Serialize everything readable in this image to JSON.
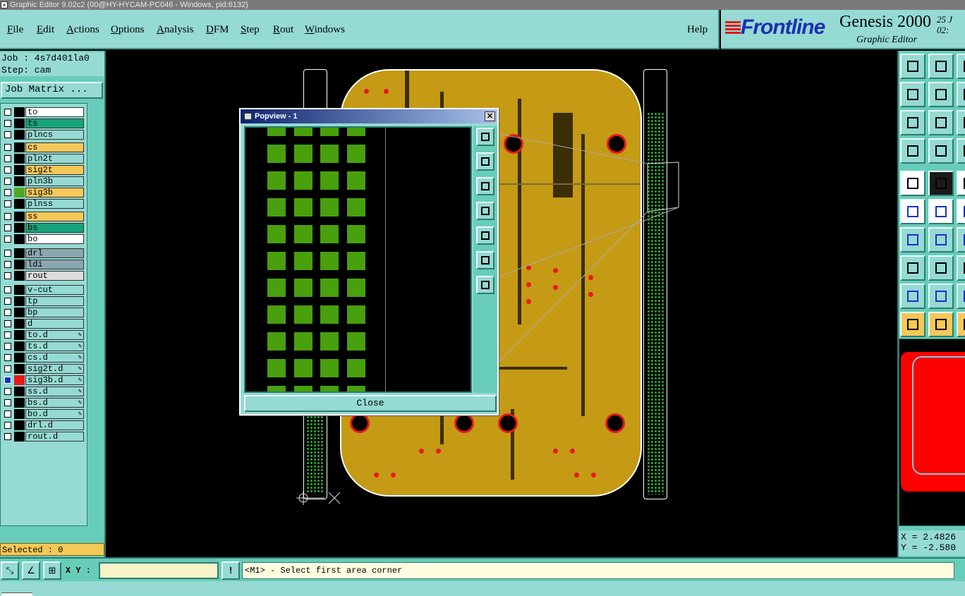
{
  "window": {
    "title": "Graphic Editor 9.02c2 (00@HY-HYCAM-PC046 - Windows, pid:6132)"
  },
  "menu": {
    "items": [
      {
        "label": "File",
        "u": "F",
        "rest": "ile"
      },
      {
        "label": "Edit",
        "u": "E",
        "rest": "dit"
      },
      {
        "label": "Actions",
        "u": "A",
        "rest": "ctions"
      },
      {
        "label": "Options",
        "u": "O",
        "rest": "ptions"
      },
      {
        "label": "Analysis",
        "u": "A",
        "rest": "nalysis"
      },
      {
        "label": "DFM",
        "u": "D",
        "rest": "FM"
      },
      {
        "label": "Step",
        "u": "S",
        "rest": "tep"
      },
      {
        "label": "Rout",
        "u": "R",
        "rest": "out"
      },
      {
        "label": "Windows",
        "u": "W",
        "rest": "indows"
      }
    ],
    "help": "Help"
  },
  "brand": {
    "logo": "Frontline",
    "product": "Genesis 2000",
    "subtitle": "Graphic Editor",
    "date_line1": "25 J",
    "date_line2": "02:"
  },
  "job": {
    "job_line": "Job : 4s7d401la0",
    "step_line": "Step: cam",
    "matrix_button": "Job Matrix ..."
  },
  "layers": [
    {
      "name": "to",
      "color": "#ffffff",
      "swatch": "#000000",
      "editable": false
    },
    {
      "name": "ts",
      "color": "#17a37a",
      "swatch": "#000000",
      "editable": false
    },
    {
      "name": "plncs",
      "color": "#95dad3",
      "swatch": "#000000",
      "editable": false
    },
    {
      "name": "cs",
      "color": "#f6c858",
      "swatch": "#000000",
      "editable": false
    },
    {
      "name": "pln2t",
      "color": "#95dad3",
      "swatch": "#000000",
      "editable": false
    },
    {
      "name": "sig2t",
      "color": "#f6c858",
      "swatch": "#000000",
      "editable": false
    },
    {
      "name": "pln3b",
      "color": "#95dad3",
      "swatch": "#000000",
      "editable": false
    },
    {
      "name": "sig3b",
      "color": "#f6c858",
      "swatch": "#4caa20",
      "editable": false
    },
    {
      "name": "plnss",
      "color": "#95dad3",
      "swatch": "#000000",
      "editable": false
    },
    {
      "name": "ss",
      "color": "#f6c858",
      "swatch": "#000000",
      "editable": false
    },
    {
      "name": "bs",
      "color": "#17a37a",
      "swatch": "#000000",
      "editable": false
    },
    {
      "name": "bo",
      "color": "#ffffff",
      "swatch": "#000000",
      "editable": false
    },
    {
      "name": "drl",
      "color": "#8aa6b0",
      "swatch": "#000000",
      "editable": false
    },
    {
      "name": "ldi",
      "color": "#8aa6b0",
      "swatch": "#000000",
      "editable": false
    },
    {
      "name": "rout",
      "color": "#dcdcdc",
      "swatch": "#000000",
      "editable": false
    },
    {
      "name": "v-cut",
      "color": "#95dad3",
      "swatch": "#000000",
      "editable": false
    },
    {
      "name": "tp",
      "color": "#95dad3",
      "swatch": "#000000",
      "editable": false
    },
    {
      "name": "bp",
      "color": "#95dad3",
      "swatch": "#000000",
      "editable": false
    },
    {
      "name": "d",
      "color": "#95dad3",
      "swatch": "#000000",
      "editable": false
    },
    {
      "name": "to.d",
      "color": "#95dad3",
      "swatch": "#000000",
      "editable": true
    },
    {
      "name": "ts.d",
      "color": "#95dad3",
      "swatch": "#000000",
      "editable": true
    },
    {
      "name": "cs.d",
      "color": "#95dad3",
      "swatch": "#000000",
      "editable": true
    },
    {
      "name": "sig2t.d",
      "color": "#95dad3",
      "swatch": "#000000",
      "editable": true
    },
    {
      "name": "sig3b.d",
      "color": "#95dad3",
      "swatch": "#e81818",
      "editable": true
    },
    {
      "name": "ss.d",
      "color": "#95dad3",
      "swatch": "#000000",
      "editable": true
    },
    {
      "name": "bs.d",
      "color": "#95dad3",
      "swatch": "#000000",
      "editable": true
    },
    {
      "name": "bo.d",
      "color": "#95dad3",
      "swatch": "#000000",
      "editable": true
    },
    {
      "name": "drl.d",
      "color": "#95dad3",
      "swatch": "#000000",
      "editable": false
    },
    {
      "name": "rout.d",
      "color": "#95dad3",
      "swatch": "#000000",
      "editable": false
    }
  ],
  "selected": "Selected : 0",
  "popview": {
    "title": "Popview - 1",
    "close_label": "Close",
    "close_glyph": "✕"
  },
  "coords": {
    "x": "X = 2.4826",
    "y": "Y = -2.580"
  },
  "bottom": {
    "xy_label": "X Y :",
    "xy_value": "",
    "alert_glyph": "!",
    "message": "<M1> - Select first area corner"
  }
}
